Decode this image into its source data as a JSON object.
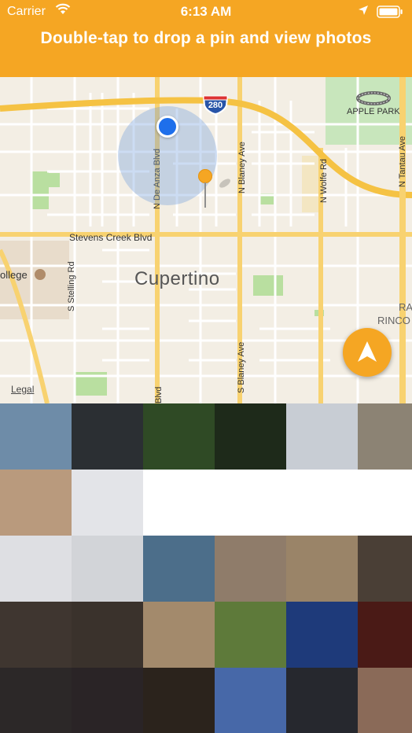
{
  "status_bar": {
    "carrier": "Carrier",
    "time": "6:13 AM"
  },
  "header": {
    "instruction": "Double-tap to drop a pin and view photos",
    "bg_color": "#F5A623"
  },
  "map": {
    "labels": {
      "apple_park": "APPLE PARK",
      "highway": "280",
      "n_de_anza_blvd": "N De Anza Blvd",
      "n_blaney_ave": "N Blaney Ave",
      "n_wolfe_rd": "N Wolfe Rd",
      "n_tantau_ave": "N Tantau Ave",
      "stevens_creek_blvd": "Stevens Creek Blvd",
      "s_stelling_rd": "S Stelling Rd",
      "college": "ollege",
      "city": "Cupertino",
      "s_blaney_ave": "S Blaney Ave",
      "bottom_blvd": "Blvd",
      "ran": "RAN",
      "rinco": "RINCO",
      "legal": "Legal"
    }
  },
  "photos": [
    [
      "#6E8CA8",
      "#2B2F33",
      "#2F4A25",
      "#1E2A1A",
      "#C8CDD4",
      "#8C8374"
    ],
    [
      "#B99A7D",
      "#E3E4E8",
      "#FFFFFF",
      "#FFFFFF",
      "#FFFFFF",
      "#FFFFFF"
    ],
    [
      "#DEDFE3",
      "#D2D4D8",
      "#4C6E8A",
      "#8F7C6A",
      "#9A8468",
      "#4A3F36"
    ],
    [
      "#3F3630",
      "#3A322C",
      "#A38A6C",
      "#5E7A3A",
      "#1E3A7A",
      "#4A1A16"
    ],
    [
      "#2C2828",
      "#2A2426",
      "#2B231C",
      "#4768A8",
      "#26282E",
      "#8A6A58"
    ]
  ]
}
